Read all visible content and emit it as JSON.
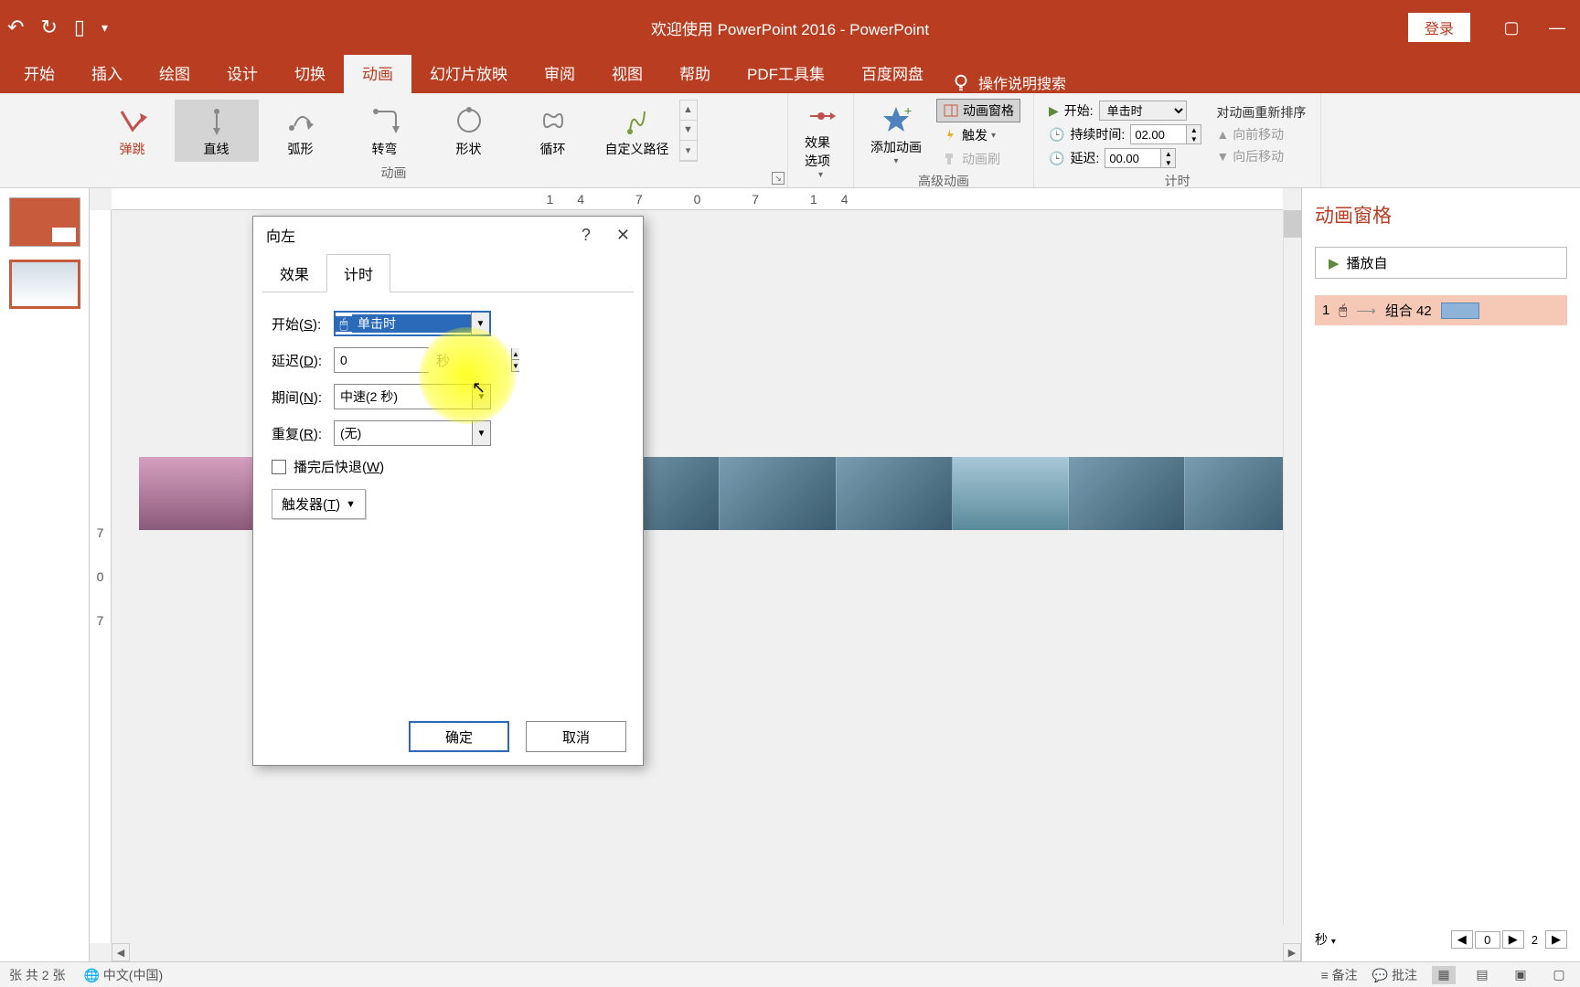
{
  "titlebar": {
    "title": "欢迎使用 PowerPoint 2016  -  PowerPoint",
    "login": "登录"
  },
  "tabs": [
    "开始",
    "插入",
    "绘图",
    "设计",
    "切换",
    "动画",
    "幻灯片放映",
    "审阅",
    "视图",
    "帮助",
    "PDF工具集",
    "百度网盘"
  ],
  "active_tab": "动画",
  "tell_me": "操作说明搜索",
  "ribbon": {
    "gallery": [
      {
        "label": "弹跳"
      },
      {
        "label": "直线"
      },
      {
        "label": "弧形"
      },
      {
        "label": "转弯"
      },
      {
        "label": "形状"
      },
      {
        "label": "循环"
      },
      {
        "label": "自定义路径"
      }
    ],
    "group_anim": "动画",
    "effect_options": "效果选项",
    "add_anim": "添加动画",
    "anim_pane_btn": "动画窗格",
    "trigger": "触发",
    "anim_painter": "动画刷",
    "group_advanced": "高级动画",
    "start_label": "开始:",
    "start_value": "单击时",
    "duration_label": "持续时间:",
    "duration_value": "02.00",
    "delay_label": "延迟:",
    "delay_value": "00.00",
    "group_timing": "计时",
    "reorder_title": "对动画重新排序",
    "move_earlier": "向前移动",
    "move_later": "向后移动"
  },
  "ruler_h": "14  7   0   7   14",
  "ruler_v": [
    "7",
    "0",
    "7"
  ],
  "anim_pane": {
    "title": "动画窗格",
    "play_from": "播放自",
    "item_num": "1",
    "item_label": "组合 42",
    "sec": "秒",
    "page_current": "0",
    "page_total": "2"
  },
  "dialog": {
    "title": "向左",
    "tabs": {
      "effect": "效果",
      "timing": "计时"
    },
    "start_label": "开始(S):",
    "start_value": "单击时",
    "delay_label": "延迟(D):",
    "delay_value": "0",
    "sec": "秒",
    "duration_label": "期间(N):",
    "duration_value": "中速(2 秒)",
    "repeat_label": "重复(R):",
    "repeat_value": "(无)",
    "rewind": "播完后快退(W)",
    "trigger": "触发器(T)",
    "ok": "确定",
    "cancel": "取消"
  },
  "status": {
    "slide_info": "张  共 2 张",
    "lang": "中文(中国)",
    "notes": "备注",
    "comments": "批注"
  }
}
